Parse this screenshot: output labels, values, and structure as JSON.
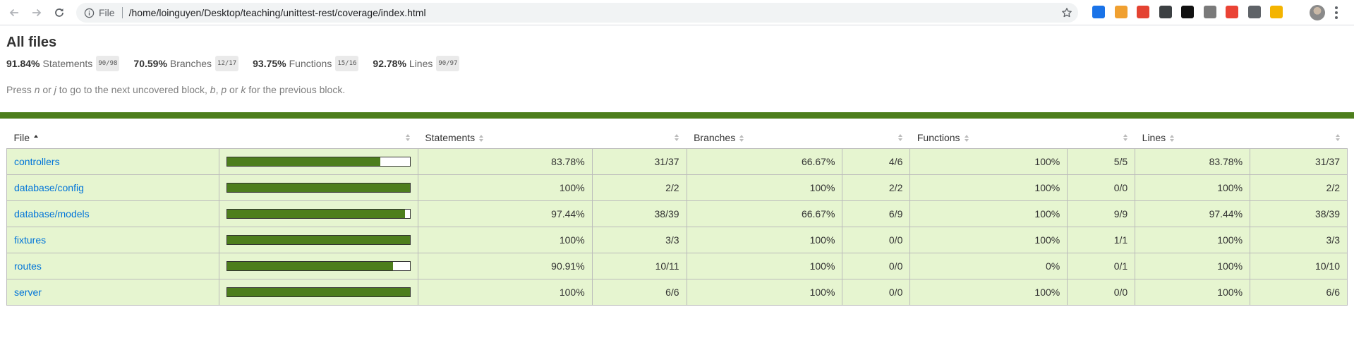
{
  "browser": {
    "scheme_label": "File",
    "url": "/home/loinguyen/Desktop/teaching/unittest-rest/coverage/index.html",
    "extensions": [
      {
        "name": "edge-icon",
        "color": "#1a73e8"
      },
      {
        "name": "owl-icon",
        "color": "#f0a030"
      },
      {
        "name": "todoist-icon",
        "color": "#e44332"
      },
      {
        "name": "video-camera-icon",
        "color": "#3c4043"
      },
      {
        "name": "notion-icon",
        "color": "#111111"
      },
      {
        "name": "shield-icon",
        "color": "#7a7a7a"
      },
      {
        "name": "bookmark-red-icon",
        "color": "#ea4335"
      },
      {
        "name": "gear-icon",
        "color": "#5f6368"
      },
      {
        "name": "note-yellow-icon",
        "color": "#f4b400"
      }
    ]
  },
  "report": {
    "title": "All files",
    "summary": [
      {
        "pct": "91.84%",
        "label": "Statements",
        "fraction": "90/98"
      },
      {
        "pct": "70.59%",
        "label": "Branches",
        "fraction": "12/17"
      },
      {
        "pct": "93.75%",
        "label": "Functions",
        "fraction": "15/16"
      },
      {
        "pct": "92.78%",
        "label": "Lines",
        "fraction": "90/97"
      }
    ],
    "hint": {
      "p1": "Press ",
      "k1": "n",
      "p2": " or ",
      "k2": "j",
      "p3": " to go to the next uncovered block, ",
      "k3": "b",
      "p4": ", ",
      "k4": "p",
      "p5": " or ",
      "k5": "k",
      "p6": " for the previous block."
    },
    "status_color": "#4d7e1c",
    "columns": {
      "file": "File",
      "statements": "Statements",
      "branches": "Branches",
      "functions": "Functions",
      "lines": "Lines"
    },
    "colors": {
      "high": "#e6f5d0",
      "medium": "#fff4c2",
      "low": "#fce1e5",
      "bar": "#4d7e1c",
      "link": "#0074d9"
    },
    "rows": [
      {
        "file": "controllers",
        "bar_pct": 83.78,
        "stmt_pct": "83.78%",
        "stmt_frac": "31/37",
        "br_pct": "66.67%",
        "br_frac": "4/6",
        "fn_pct": "100%",
        "fn_frac": "5/5",
        "ln_pct": "83.78%",
        "ln_frac": "31/37",
        "br_level": "medium",
        "fn_level": "high"
      },
      {
        "file": "database/config",
        "bar_pct": 100,
        "stmt_pct": "100%",
        "stmt_frac": "2/2",
        "br_pct": "100%",
        "br_frac": "2/2",
        "fn_pct": "100%",
        "fn_frac": "0/0",
        "ln_pct": "100%",
        "ln_frac": "2/2",
        "br_level": "high",
        "fn_level": "high"
      },
      {
        "file": "database/models",
        "bar_pct": 97.44,
        "stmt_pct": "97.44%",
        "stmt_frac": "38/39",
        "br_pct": "66.67%",
        "br_frac": "6/9",
        "fn_pct": "100%",
        "fn_frac": "9/9",
        "ln_pct": "97.44%",
        "ln_frac": "38/39",
        "br_level": "medium",
        "fn_level": "high"
      },
      {
        "file": "fixtures",
        "bar_pct": 100,
        "stmt_pct": "100%",
        "stmt_frac": "3/3",
        "br_pct": "100%",
        "br_frac": "0/0",
        "fn_pct": "100%",
        "fn_frac": "1/1",
        "ln_pct": "100%",
        "ln_frac": "3/3",
        "br_level": "high",
        "fn_level": "high"
      },
      {
        "file": "routes",
        "bar_pct": 90.91,
        "stmt_pct": "90.91%",
        "stmt_frac": "10/11",
        "br_pct": "100%",
        "br_frac": "0/0",
        "fn_pct": "0%",
        "fn_frac": "0/1",
        "ln_pct": "100%",
        "ln_frac": "10/10",
        "br_level": "high",
        "fn_level": "low"
      },
      {
        "file": "server",
        "bar_pct": 100,
        "stmt_pct": "100%",
        "stmt_frac": "6/6",
        "br_pct": "100%",
        "br_frac": "0/0",
        "fn_pct": "100%",
        "fn_frac": "0/0",
        "ln_pct": "100%",
        "ln_frac": "6/6",
        "br_level": "high",
        "fn_level": "high"
      }
    ]
  }
}
